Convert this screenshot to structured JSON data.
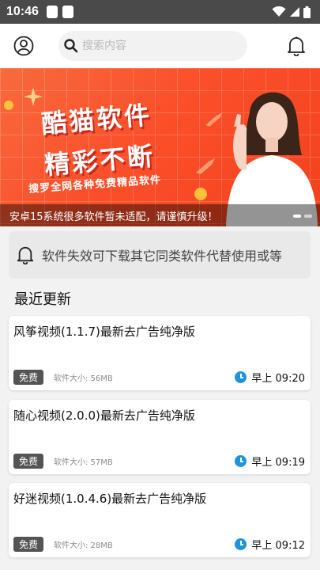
{
  "status_bar": {
    "time": "10:46"
  },
  "header": {
    "search_placeholder": "搜索内容"
  },
  "banner": {
    "line1": "酷猫软件",
    "line2": "精彩不断",
    "line3": "搜罗全网各种免费精品软件",
    "caption": "安卓15系统很多软件暂未适配，请谨慎升级！"
  },
  "notice": {
    "text": "软件失效可下载其它同类软件代替使用或等"
  },
  "section": {
    "title": "最近更新"
  },
  "apps": [
    {
      "title": "风筝视频(1.1.7)最新去广告纯净版",
      "tag": "免费",
      "size": "软件大小: 56MB",
      "time": "早上 09:20"
    },
    {
      "title": "随心视频(2.0.0)最新去广告纯净版",
      "tag": "免费",
      "size": "软件大小: 57MB",
      "time": "早上 09:19"
    },
    {
      "title": "好迷视频(1.0.4.6)最新去广告纯净版",
      "tag": "免费",
      "size": "软件大小: 28MB",
      "time": "早上 09:12"
    }
  ],
  "colors": {
    "accent": "#1f93d9",
    "banner": "#f5502a",
    "tag": "#545454"
  }
}
